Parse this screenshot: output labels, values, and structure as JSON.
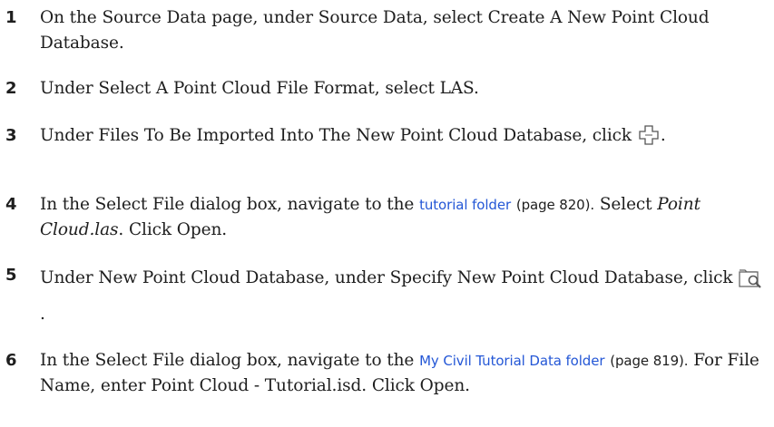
{
  "steps": [
    {
      "num": "1",
      "text": "On the Source Data page, under Source Data, select Create A New Point Cloud Database."
    },
    {
      "num": "2",
      "text": "Under Select A Point Cloud File Format, select LAS."
    },
    {
      "num": "3",
      "text": "Under Files To Be Imported Into The New Point Cloud Database, click",
      "after_icon": "."
    },
    {
      "num": "4",
      "before_link": "In the Select File dialog box, navigate to the",
      "link": "tutorial folder",
      "page_ref": "(page 820).",
      "middle": "Select",
      "italic": "Point Cloud.las",
      "end": ". Click Open."
    },
    {
      "num": "5",
      "text": "Under New Point Cloud Database, under Specify New Point Cloud Database, click",
      "after_icon": "."
    },
    {
      "num": "6",
      "before_link": "In the Select File dialog box, navigate to the",
      "link": "My Civil Tutorial Data folder",
      "page_ref": "(page 819).",
      "end": "For File Name, enter Point Cloud - Tutorial.isd. Click Open."
    }
  ],
  "icons": {
    "step3": "add-icon",
    "step5": "browse-folder-icon"
  },
  "colors": {
    "link": "#2457d6",
    "text": "#1e1e1e"
  }
}
